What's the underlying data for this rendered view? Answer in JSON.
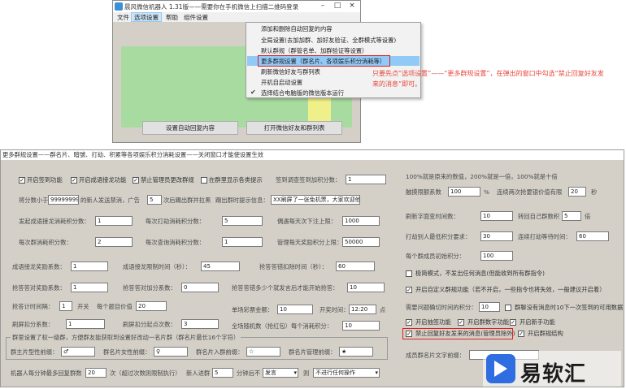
{
  "top_window": {
    "title": "晨风微信机器人 1.31版——需要你在手机微信上扫描二维码登录",
    "menu": [
      "文件",
      "选项设置",
      "帮助",
      "组件设置"
    ],
    "dropdown": [
      "添加和删除自动回复的内容",
      "全局设置(去加加群、加好友验证、全群模式等设置)",
      "默认群规（群管名单、加群验证等设置）",
      "更多群规设置（群名片、各项娱乐积分消耗等）",
      "刷新微信好友与群列表",
      "开机自启动设置",
      "选择结合电脑版的微信版本运行"
    ],
    "highlighted_index": 3,
    "checked_index": 6,
    "btn_auto_reply": "设置自动回复内容",
    "btn_open_list": "打开微信好友和群列表"
  },
  "annotation": "只要先点“选项设置”——“更多群规设置”，在弹出的窗口中勾选“禁止回复好友发来的消息”即可。",
  "settings_window": {
    "title": "更多群规设置——群名片、暗號、打劫、积累等各项娱乐积分消耗设置——关闭窗口才能使设置生效",
    "row1": {
      "cb1": "开启签到功能",
      "cb2": "开启成语接龙功能",
      "cb3": "禁止管理员更改群规",
      "cb4": "在群里显示各类提示",
      "lbl_sign": "签到调查签到加积分数：",
      "val_sign": "1"
    },
    "row2": {
      "lbl_a": "将分数小于",
      "val_a": "99999999",
      "lbl_b": "的新人发送禁消，广告",
      "val_b": "5",
      "lbl_c": "次后踢出群并拉黑",
      "lbl_d": "踢出群时提示信息：",
      "val_d": "XX刷屏了一张免机票，大家欢迎他起飞"
    },
    "row3": {
      "lbl_a": "发起成语接龙消耗积分数：",
      "val_a": "1",
      "lbl_b": "每次打劫消耗积分数：",
      "val_b": "5",
      "lbl_c": "偶遇每天次下注上限：",
      "val_c": "1000"
    },
    "row4": {
      "lbl_a": "每次群消耗积分数：",
      "val_a": "2",
      "lbl_b": "每次查询消耗积分数：",
      "val_b": "1",
      "lbl_c": "管理每天奖励积分上限：",
      "val_c": "50000"
    },
    "row5": {
      "lbl_a": "成语接龙奖励系数：",
      "val_a": "1",
      "lbl_b": "成语接龙限制时间（秒）：",
      "val_b": "45",
      "lbl_c": "抢答答错扣除时间（秒）：",
      "val_c": "60"
    },
    "row6": {
      "lbl_a": "抢答答对奖励系数：",
      "val_a": "1",
      "lbl_b": "抢答答对加分系数：",
      "val_b": "0",
      "lbl_c": "抢答答错多少个就发言后才能开始抢答：",
      "val_c": "10"
    },
    "row7": {
      "lbl_a": "抢答计时间隔：",
      "val_a": "1",
      "lbl_b": "开关",
      "lbl_c": "每个题目价值",
      "val_c": "20",
      "lbl_d": "单场彩票金额：",
      "val_d": "10",
      "lbl_e": "开奖时间：",
      "val_e": "12:20",
      "lbl_f": "点"
    },
    "row8": {
      "lbl_a": "刷屏扣分系数：",
      "val_a": "1",
      "lbl_b": "刷屏扣分起点次数：",
      "val_b": "3",
      "lbl_c": "全场随机数（抢红包）每个消耗积分：",
      "val_c": "10"
    },
    "group_title": "群里设置了权一级群，方便群友能获取到设置好改动一名片群（群名片最长16个字符）",
    "row9": {
      "lbl_a": "群主片型性前缀：",
      "val_a": "♂",
      "lbl_b": "群名片女性前缀：",
      "val_b": "♀",
      "lbl_c": "群名片入群前缀：",
      "val_c": "☆",
      "lbl_d": "群名片管理前缀：",
      "val_d": "★"
    },
    "row10": {
      "lbl_a": "机器人每分钟最多回复群数",
      "val_a": "20",
      "lbl_b": "次（超过次数则限制执行）",
      "lbl_c": "新人进群",
      "val_c": "5",
      "lbl_d": "分钟后不",
      "val_d": "发言",
      "lbl_e": "则",
      "val_e": "不进行任何操作"
    },
    "right": {
      "note": "100%就是原来的数值，200%就是一倍，100%就是十倍",
      "lbl_a": "触摸限额系数",
      "val_a": "100",
      "unit_a": "%",
      "lbl_b": "连续两次抢要银价值有限",
      "val_b": "20",
      "unit_b": "秒",
      "lbl_c": "刷新字面变时间数：",
      "val_c": "10",
      "lbl_d": "转回自己群数积",
      "val_d": "5",
      "unit_d": "倍",
      "lbl_e": "打劫别人最低积分要求：",
      "val_e": "30",
      "lbl_f": "连续打劫等待时间：",
      "val_f": "60",
      "lbl_g": "每个群成员初始积分：",
      "val_g": "100",
      "cb_a": "极简模式，不发出任何消息(但能收到所有群指令)",
      "cb_b": "开启自定义群规功能（若不开启，一些指令也将失效，一般建议开启着）",
      "lbl_h": "需要问题确切时间的积分：",
      "val_h": "10",
      "cb_c": "群聊没有消息时10下一次签到的可用数据",
      "cb_d": "开启抽签功能",
      "cb_e": "开启群数字功能",
      "cb_f": "开启新手功能",
      "cb_g": "禁止回复好友发来的消息(管理员除外)",
      "cb_h": "开启群规结构",
      "lbl_i": "成员群名片文字前缀："
    }
  },
  "watermark": "易软汇"
}
